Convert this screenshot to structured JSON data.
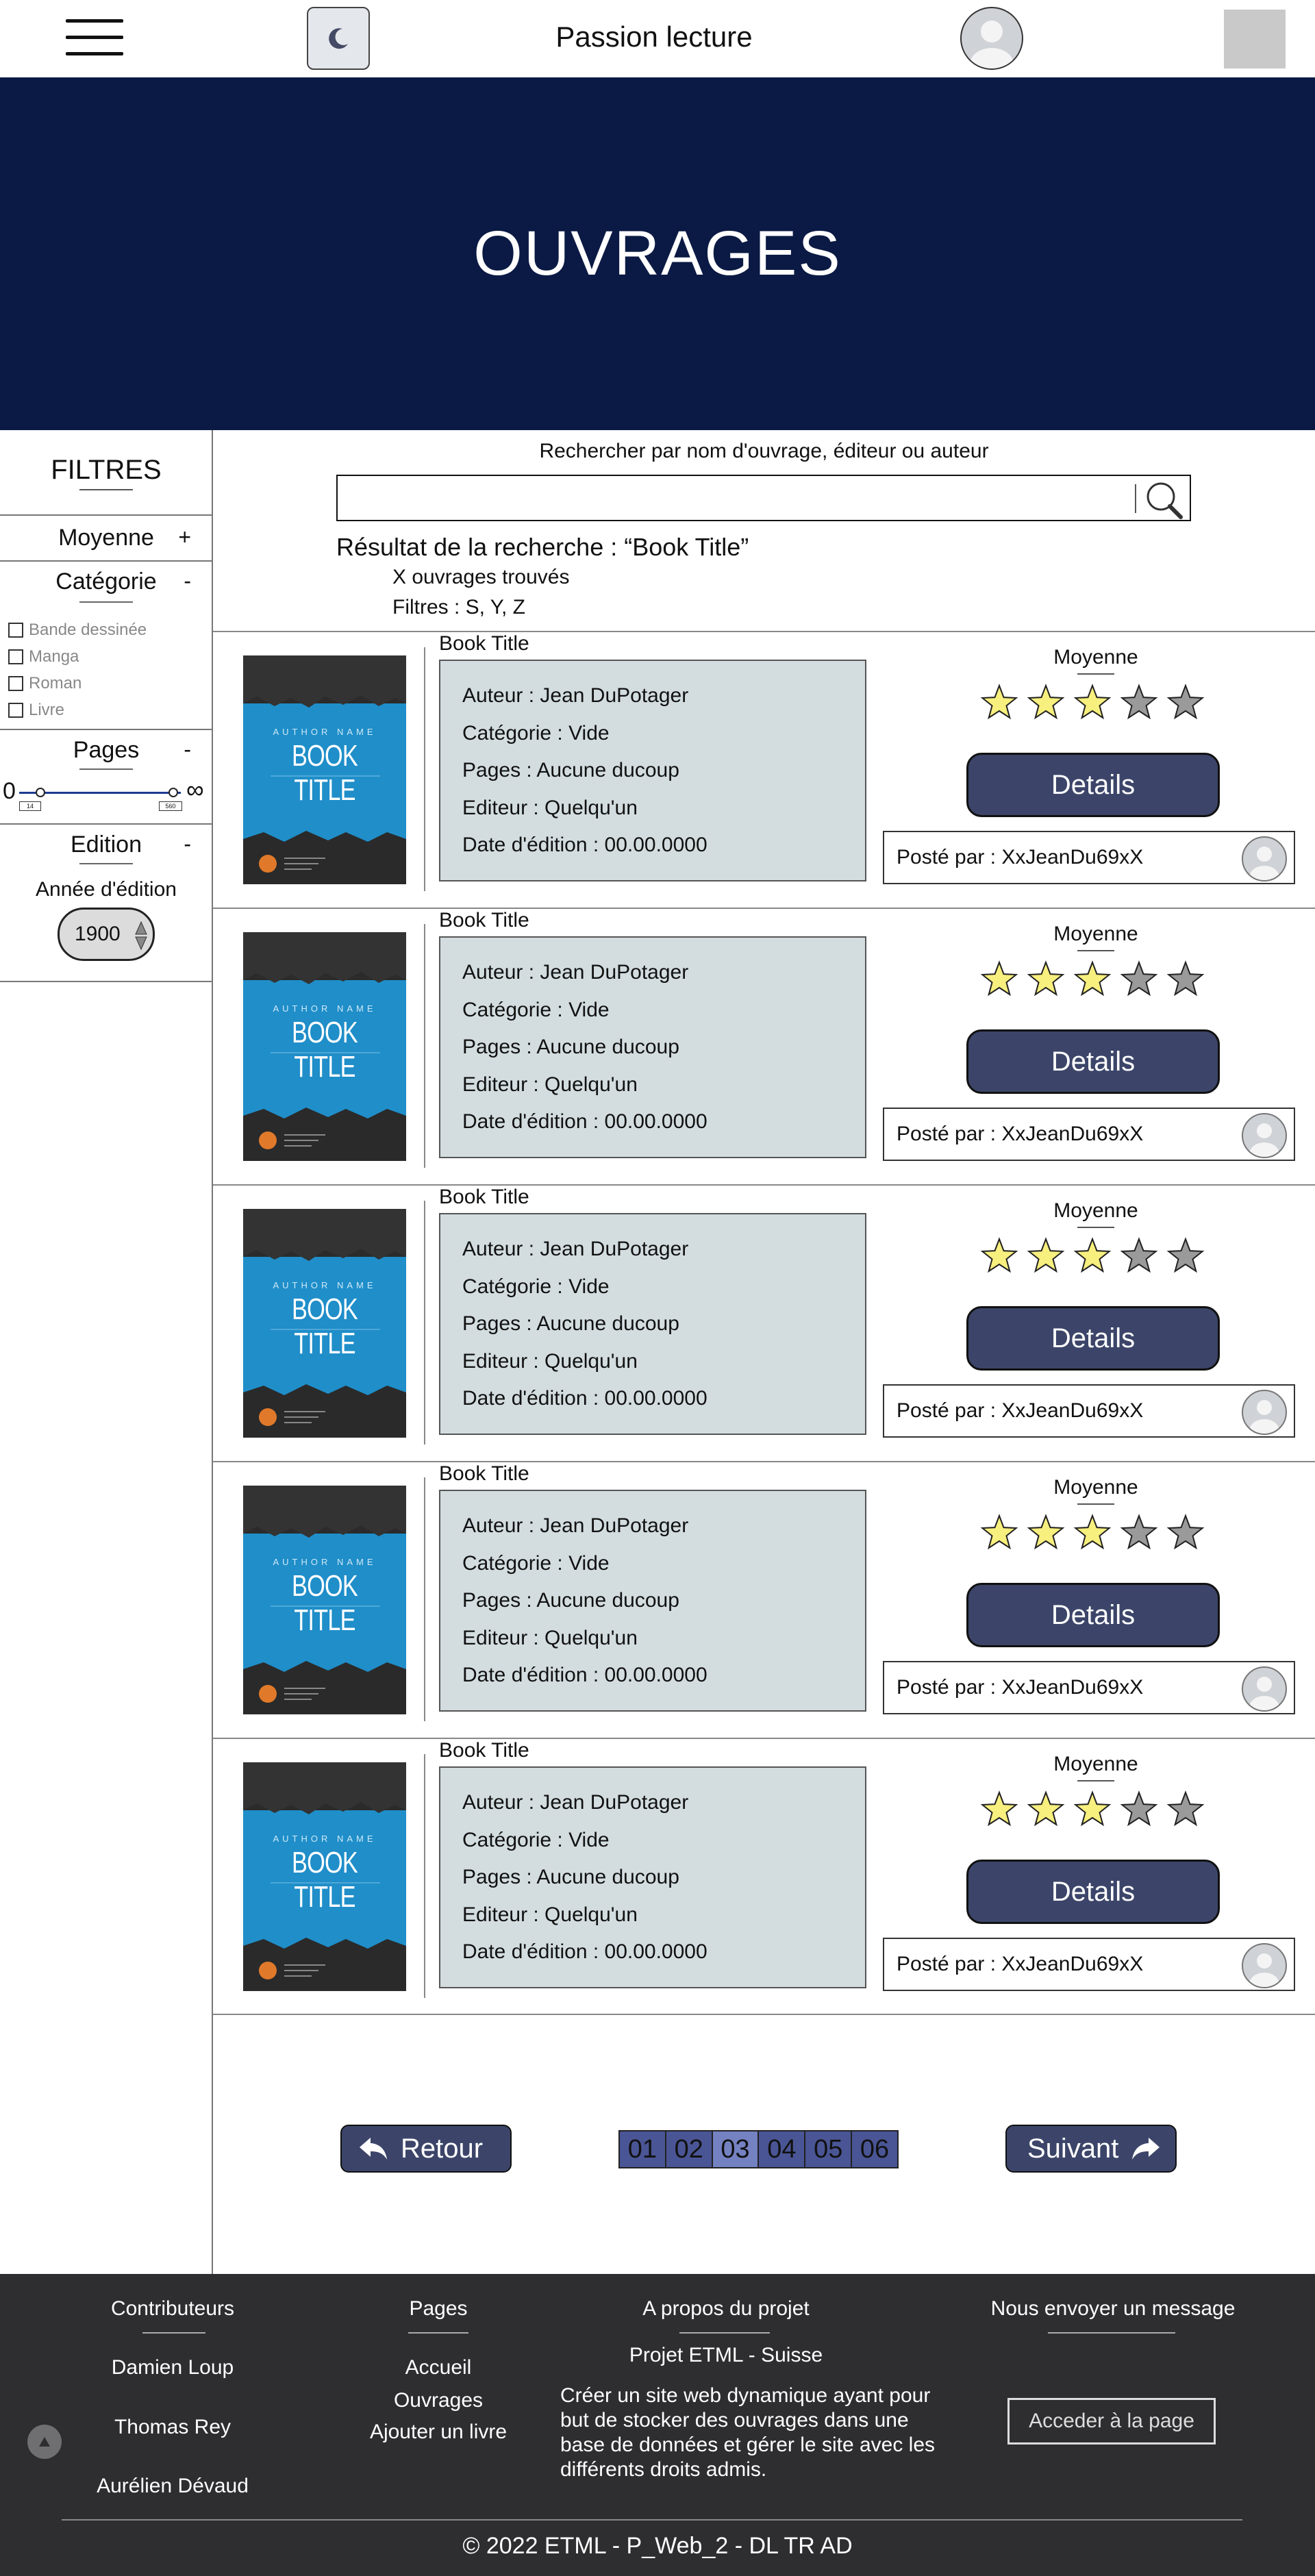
{
  "header": {
    "title": "Passion lecture",
    "menu_icon": "hamburger-menu-icon",
    "theme_icon": "moon-icon"
  },
  "hero": {
    "title": "OUVRAGES"
  },
  "sidebar": {
    "title": "FILTRES",
    "sections": {
      "moyenne": {
        "label": "Moyenne",
        "toggle": "+"
      },
      "categorie": {
        "label": "Catégorie",
        "toggle": "-",
        "options": [
          "Bande dessinée",
          "Manga",
          "Roman",
          "Livre"
        ]
      },
      "pages": {
        "label": "Pages",
        "toggle": "-",
        "min_label": "0",
        "max_label": "∞",
        "range_min": "14",
        "range_max": "560"
      },
      "edition": {
        "label": "Edition",
        "toggle": "-",
        "year_label": "Année d'édition",
        "year_value": "1900"
      }
    }
  },
  "search": {
    "label": "Rechercher par nom d'ouvrage, éditeur ou auteur",
    "value": "",
    "result_title": "Résultat de la recherche : “Book Title”",
    "result_count": "X ouvrages trouvés",
    "result_filters": "Filtres : S, Y, Z"
  },
  "books": [
    {
      "title": "Book Title",
      "author": "Auteur : Jean DuPotager",
      "category": "Catégorie : Vide",
      "pages": "Pages : Aucune ducoup",
      "editor": "Editeur : Quelqu'un",
      "date": "Date d'édition : 00.00.0000",
      "avg_label": "Moyenne",
      "rating": 3,
      "details": "Details",
      "posted_by": "Posté par : XxJeanDu69xX",
      "cover_author": "AUTHOR NAME",
      "cover_title": "BOOK TITLE"
    },
    {
      "title": "Book Title",
      "author": "Auteur : Jean DuPotager",
      "category": "Catégorie : Vide",
      "pages": "Pages : Aucune ducoup",
      "editor": "Editeur : Quelqu'un",
      "date": "Date d'édition : 00.00.0000",
      "avg_label": "Moyenne",
      "rating": 3,
      "details": "Details",
      "posted_by": "Posté par : XxJeanDu69xX",
      "cover_author": "AUTHOR NAME",
      "cover_title": "BOOK TITLE"
    },
    {
      "title": "Book Title",
      "author": "Auteur : Jean DuPotager",
      "category": "Catégorie : Vide",
      "pages": "Pages : Aucune ducoup",
      "editor": "Editeur : Quelqu'un",
      "date": "Date d'édition : 00.00.0000",
      "avg_label": "Moyenne",
      "rating": 3,
      "details": "Details",
      "posted_by": "Posté par : XxJeanDu69xX",
      "cover_author": "AUTHOR NAME",
      "cover_title": "BOOK TITLE"
    },
    {
      "title": "Book Title",
      "author": "Auteur : Jean DuPotager",
      "category": "Catégorie : Vide",
      "pages": "Pages : Aucune ducoup",
      "editor": "Editeur : Quelqu'un",
      "date": "Date d'édition : 00.00.0000",
      "avg_label": "Moyenne",
      "rating": 3,
      "details": "Details",
      "posted_by": "Posté par : XxJeanDu69xX",
      "cover_author": "AUTHOR NAME",
      "cover_title": "BOOK TITLE"
    },
    {
      "title": "Book Title",
      "author": "Auteur : Jean DuPotager",
      "category": "Catégorie : Vide",
      "pages": "Pages : Aucune ducoup",
      "editor": "Editeur : Quelqu'un",
      "date": "Date d'édition : 00.00.0000",
      "avg_label": "Moyenne",
      "rating": 3,
      "details": "Details",
      "posted_by": "Posté par : XxJeanDu69xX",
      "cover_author": "AUTHOR NAME",
      "cover_title": "BOOK TITLE"
    }
  ],
  "rating_max": 5,
  "pagination": {
    "prev_label": "Retour",
    "next_label": "Suivant",
    "pages": [
      "01",
      "02",
      "03",
      "04",
      "05",
      "06"
    ],
    "current": "03"
  },
  "footer": {
    "contributors": {
      "title": "Contributeurs",
      "names": [
        "Damien Loup",
        "Thomas Rey",
        "Aurélien Dévaud"
      ]
    },
    "pages": {
      "title": "Pages",
      "links": [
        "Accueil",
        "Ouvrages",
        "Ajouter un livre"
      ]
    },
    "about": {
      "title": "A propos du projet",
      "subtitle": "Projet ETML - Suisse",
      "description": "Créer un site web dynamique ayant pour but de stocker des ouvrages dans une base de données et gérer le site avec les différents droits admis."
    },
    "contact": {
      "title": "Nous envoyer un message",
      "button": "Acceder à la page"
    },
    "copyright": "© 2022 ETML - P_Web_2 - DL TR AD"
  },
  "colors": {
    "hero_bg": "#0b1a44",
    "button_bg": "#3c4569",
    "info_bg": "#d3dde0",
    "footer_bg": "#2e2e30",
    "pager_bg": "#4a5595",
    "pager_active": "#7482c2",
    "star_filled": "#f7ef7e",
    "star_empty": "#9a9a9a"
  }
}
